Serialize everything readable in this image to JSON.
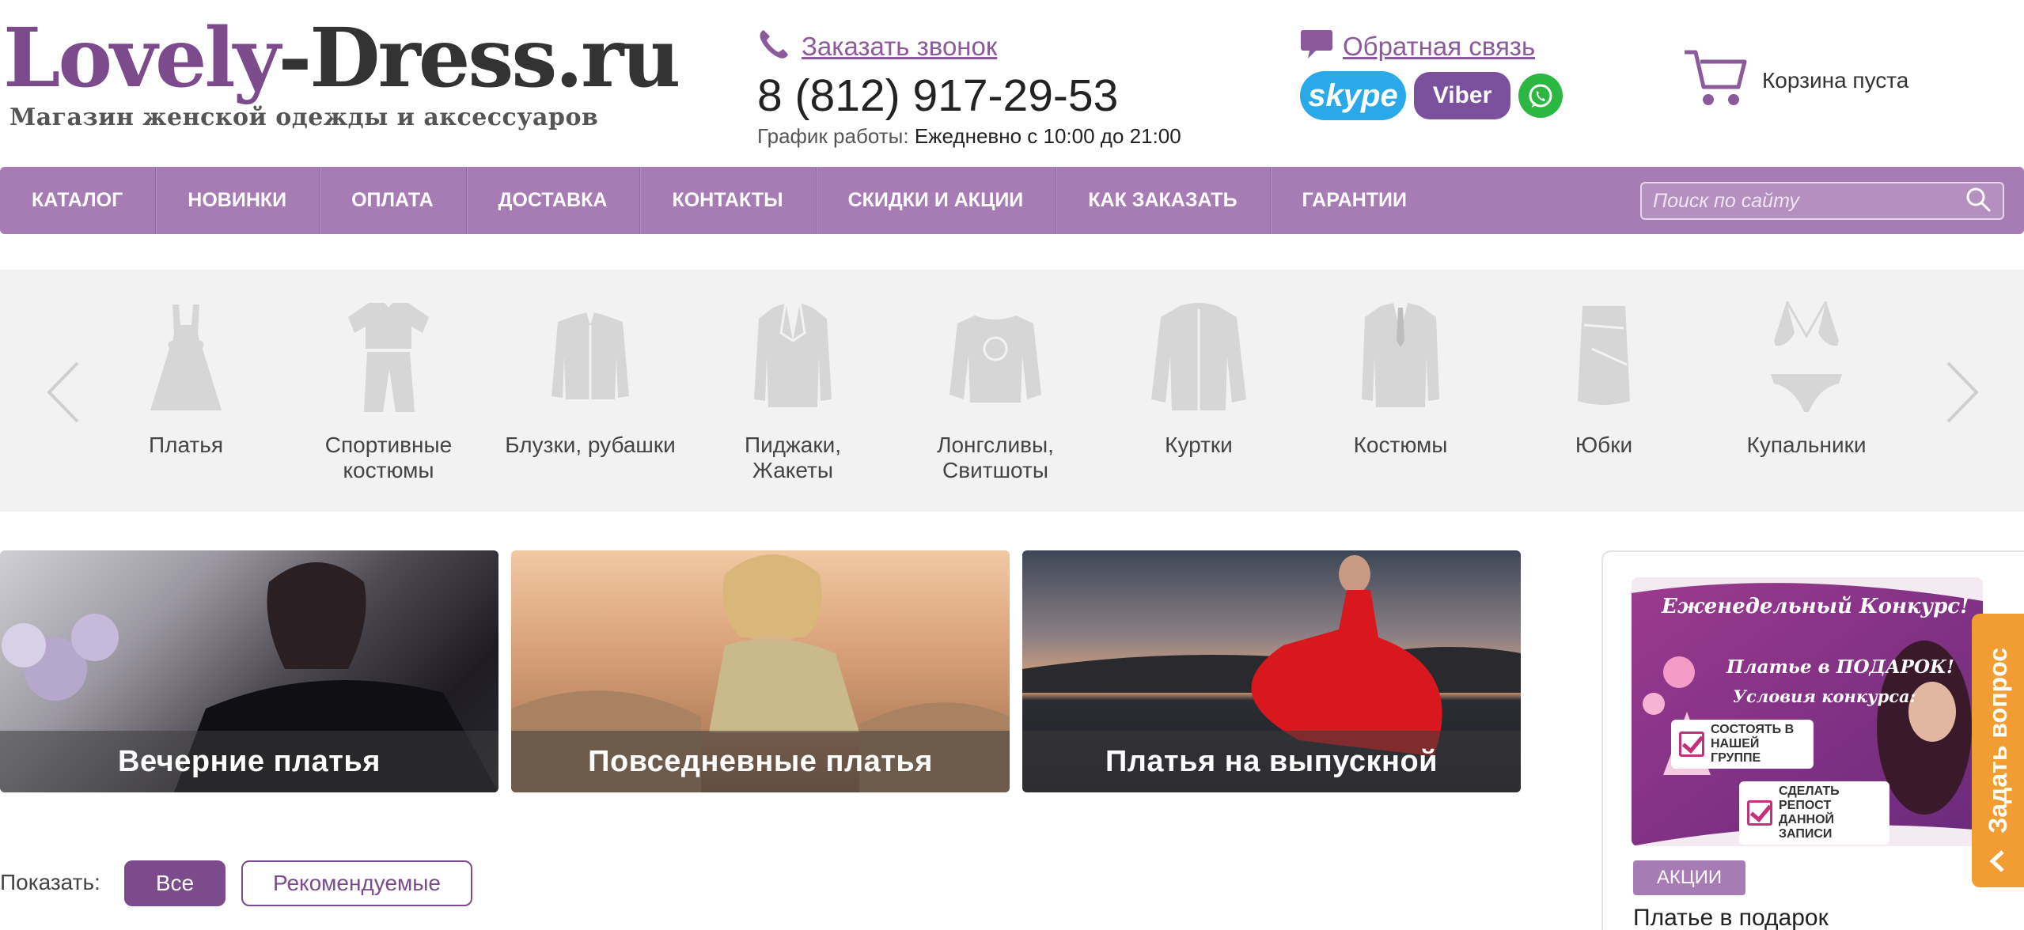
{
  "logo": {
    "part1": "Lovely",
    "dash": "-",
    "part2": "Dress.ru",
    "tagline": "Магазин женской одежды и аксессуаров"
  },
  "header": {
    "callback_label": "Заказать звонок",
    "phone": "8 (812) 917-29-53",
    "hours_label": "График работы:",
    "hours_value": "Ежедневно с 10:00 до 21:00",
    "feedback_label": "Обратная связь",
    "skype_label": "skype",
    "viber_label": "Viber",
    "cart_label": "Корзина пуста"
  },
  "nav": {
    "items": [
      "КАТАЛОГ",
      "НОВИНКИ",
      "ОПЛАТА",
      "ДОСТАВКА",
      "КОНТАКТЫ",
      "СКИДКИ И АКЦИИ",
      "КАК ЗАКАЗАТЬ",
      "ГАРАНТИИ"
    ],
    "search_placeholder": "Поиск по сайту"
  },
  "categories": [
    {
      "label": "Платья",
      "icon": "dress-icon"
    },
    {
      "label": "Спортивные костюмы",
      "icon": "tracksuit-icon"
    },
    {
      "label": "Блузки, рубашки",
      "icon": "shirt-icon"
    },
    {
      "label": "Пиджаки, Жакеты",
      "icon": "jacket-icon"
    },
    {
      "label": "Лонгсливы, Свитшоты",
      "icon": "sweatshirt-icon"
    },
    {
      "label": "Куртки",
      "icon": "coat-icon"
    },
    {
      "label": "Костюмы",
      "icon": "suit-icon"
    },
    {
      "label": "Юбки",
      "icon": "skirt-icon"
    },
    {
      "label": "Купальники",
      "icon": "swimsuit-icon"
    }
  ],
  "banners": [
    "Вечерние платья",
    "Повседневные платья",
    "Платья на выпускной"
  ],
  "filters": {
    "show_label": "Показать:",
    "all": "Все",
    "recommended": "Рекомендуемые"
  },
  "side": {
    "promo_title": "Еженедельный Конкурс!",
    "promo_sub1": "Платье в ПОДАРОК!",
    "promo_sub2": "Условия конкурса:",
    "promo_step1": "СОСТОЯТЬ В НАШЕЙ ГРУППЕ",
    "promo_step2": "СДЕЛАТЬ РЕПОСТ ДАННОЙ ЗАПИСИ",
    "badge": "АКЦИИ",
    "caption": "Платье в подарок"
  },
  "ask_button": "Задать вопрос",
  "colors": {
    "brand": "#7b4b8c",
    "nav": "#a77bb3",
    "ask": "#f29c34"
  }
}
